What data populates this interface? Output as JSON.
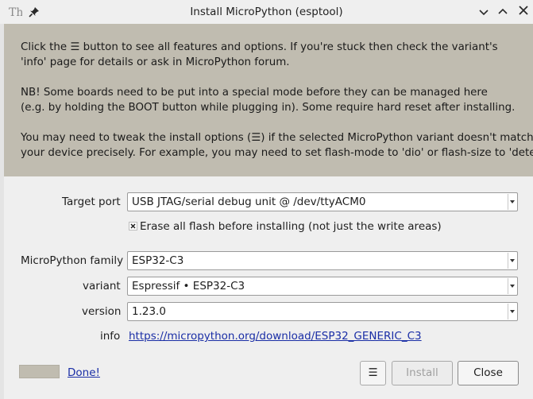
{
  "window": {
    "title": "Install MicroPython (esptool)",
    "app_icon": "thonny-icon",
    "buttons": [
      "pin-icon",
      "minimize-icon",
      "maximize-icon",
      "close-icon"
    ]
  },
  "info": {
    "para1_line1": "Click the ☰ button to see all features and options. If you're stuck then check the variant's",
    "para1_line2": "'info' page for details or ask in MicroPython forum.",
    "para2_line1": "NB! Some boards need to be put into a special mode before they can be managed here",
    "para2_line2": "(e.g. by holding the BOOT button while plugging in). Some require hard reset after installing.",
    "para3_line1": "You may need to tweak the install options (☰) if the selected MicroPython variant doesn't match",
    "para3_line2": "your device precisely. For example, you may need to set flash-mode to 'dio' or flash-size to 'detect'."
  },
  "form": {
    "target_port_label": "Target port",
    "target_port_value": "USB JTAG/serial debug unit @ /dev/ttyACM0",
    "erase_checkbox_label": "Erase all flash before installing (not just the write areas)",
    "erase_checked": true,
    "family_label": "MicroPython family",
    "family_value": "ESP32-C3",
    "variant_label": "variant",
    "variant_value": "Espressif • ESP32-C3",
    "version_label": "version",
    "version_value": "1.23.0",
    "info_label": "info",
    "info_link": "https://micropython.org/download/ESP32_GENERIC_C3"
  },
  "footer": {
    "status_link": "Done!",
    "menu_button": "☰",
    "install_button": "Install",
    "close_button": "Close"
  },
  "colors": {
    "info_background": "#c0bcb0",
    "link": "#1a2ea6",
    "window_background": "#efefef"
  }
}
